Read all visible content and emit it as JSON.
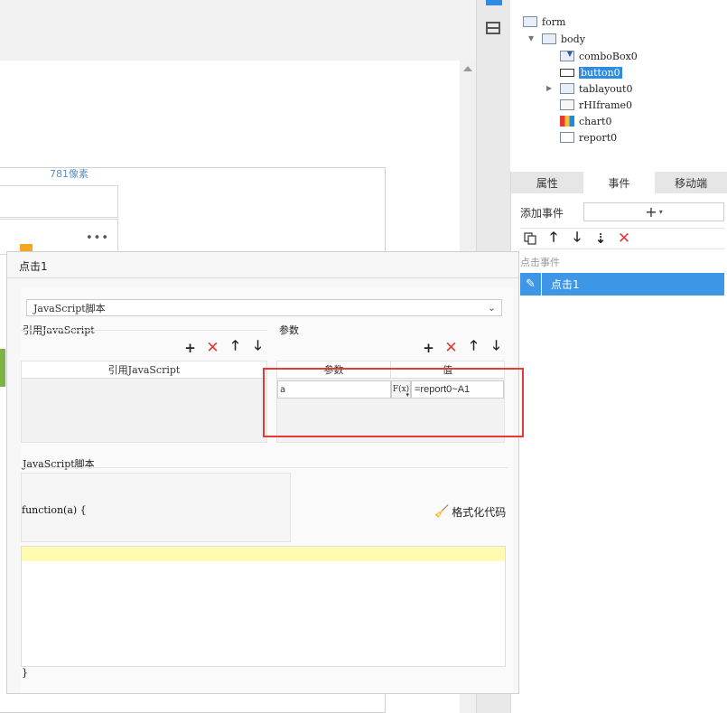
{
  "canvas": {
    "width_label": "781像素",
    "more_label": "•••"
  },
  "tree": {
    "nodes": [
      {
        "id": "form",
        "label": "form"
      },
      {
        "id": "body",
        "label": "body"
      },
      {
        "id": "combobox0",
        "label": "comboBox0"
      },
      {
        "id": "button0",
        "label": "button0",
        "selected": true
      },
      {
        "id": "tablayout0",
        "label": "tablayout0"
      },
      {
        "id": "rhiframe0",
        "label": "rHIframe0"
      },
      {
        "id": "chart0",
        "label": "chart0"
      },
      {
        "id": "report0",
        "label": "report0"
      }
    ]
  },
  "props": {
    "tabs": [
      {
        "label": "属性"
      },
      {
        "label": "事件",
        "active": true
      },
      {
        "label": "移动端"
      }
    ],
    "add_event_label": "添加事件",
    "add_event_plus": "+",
    "add_event_caret": "▾",
    "event_list_header": "点击事件",
    "event_item_label": "点击1",
    "toolbar_icons": [
      "copy-icon",
      "arrow-up-icon",
      "arrow-down-icon",
      "move-bottom-icon",
      "delete-icon"
    ]
  },
  "dialog": {
    "title": "点击1",
    "script_type": "JavaScript脚本",
    "ref_js_label": "引用JavaScript",
    "params_label": "参数",
    "ref_table_header": "引用JavaScript",
    "param_header_name": "参数",
    "param_header_value": "值",
    "param_name": "a",
    "fx_label": "F(x)",
    "param_value": "=report0~A1",
    "script_label": "JavaScript脚本",
    "function_signature": "function(a) {",
    "format_button": "格式化代码",
    "closing_brace": "}"
  },
  "colors": {
    "accent": "#2e8ce0",
    "selected_event": "#3d97e6",
    "delete": "#e53935",
    "highlight_box": "#e53935",
    "code_line_highlight": "#fffbb0"
  }
}
